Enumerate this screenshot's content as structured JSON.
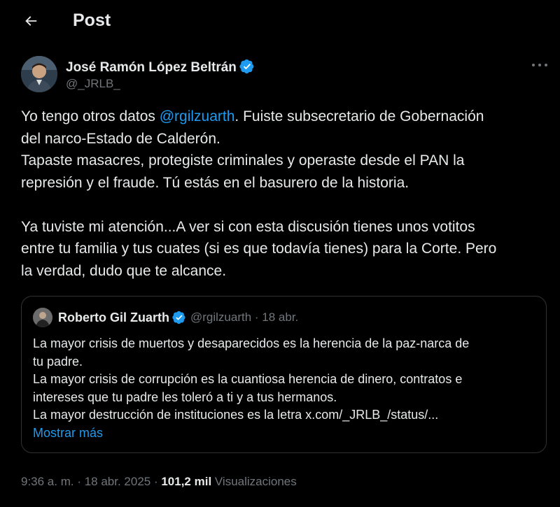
{
  "header": {
    "title": "Post"
  },
  "author": {
    "name": "José Ramón López Beltrán",
    "handle": "@_JRLB_"
  },
  "post": {
    "line1_before": "Yo tengo otros datos ",
    "mention": "@rgilzuarth",
    "line1_after": ". Fuiste subsecretario de Gobernación",
    "line2": "del narco-Estado de Calderón.",
    "line3": "Tapaste masacres, protegiste criminales y operaste desde el PAN la",
    "line4": "represión y el fraude. Tú estás en el basurero de la historia.",
    "line5": "Ya tuviste mi atención...A ver si con esta discusión tienes unos votitos",
    "line6": "entre tu familia y tus cuates (si es que todavía tienes) para la Corte. Pero",
    "line7": "la verdad, dudo que te alcance."
  },
  "quote": {
    "name": "Roberto Gil Zuarth",
    "handle_date": "@rgilzuarth · 18 abr.",
    "lines": [
      "La mayor crisis de muertos y desaparecidos es la herencia de la paz-narca de",
      "tu padre.",
      "La mayor crisis de corrupción es la cuantiosa herencia de dinero, contratos e",
      "intereses que tu padre les toleró a ti y a tus hermanos.",
      "La mayor destrucción de instituciones es la letra x.com/_JRLB_/status/..."
    ],
    "show_more": "Mostrar más"
  },
  "meta": {
    "time_date": "9:36 a. m. · 18 abr. 2025 · ",
    "views_count": "101,2 mil",
    "views_label": " Visualizaciones"
  },
  "colors": {
    "accent": "#1d9bf0",
    "background": "#000000",
    "muted": "#71767b"
  }
}
